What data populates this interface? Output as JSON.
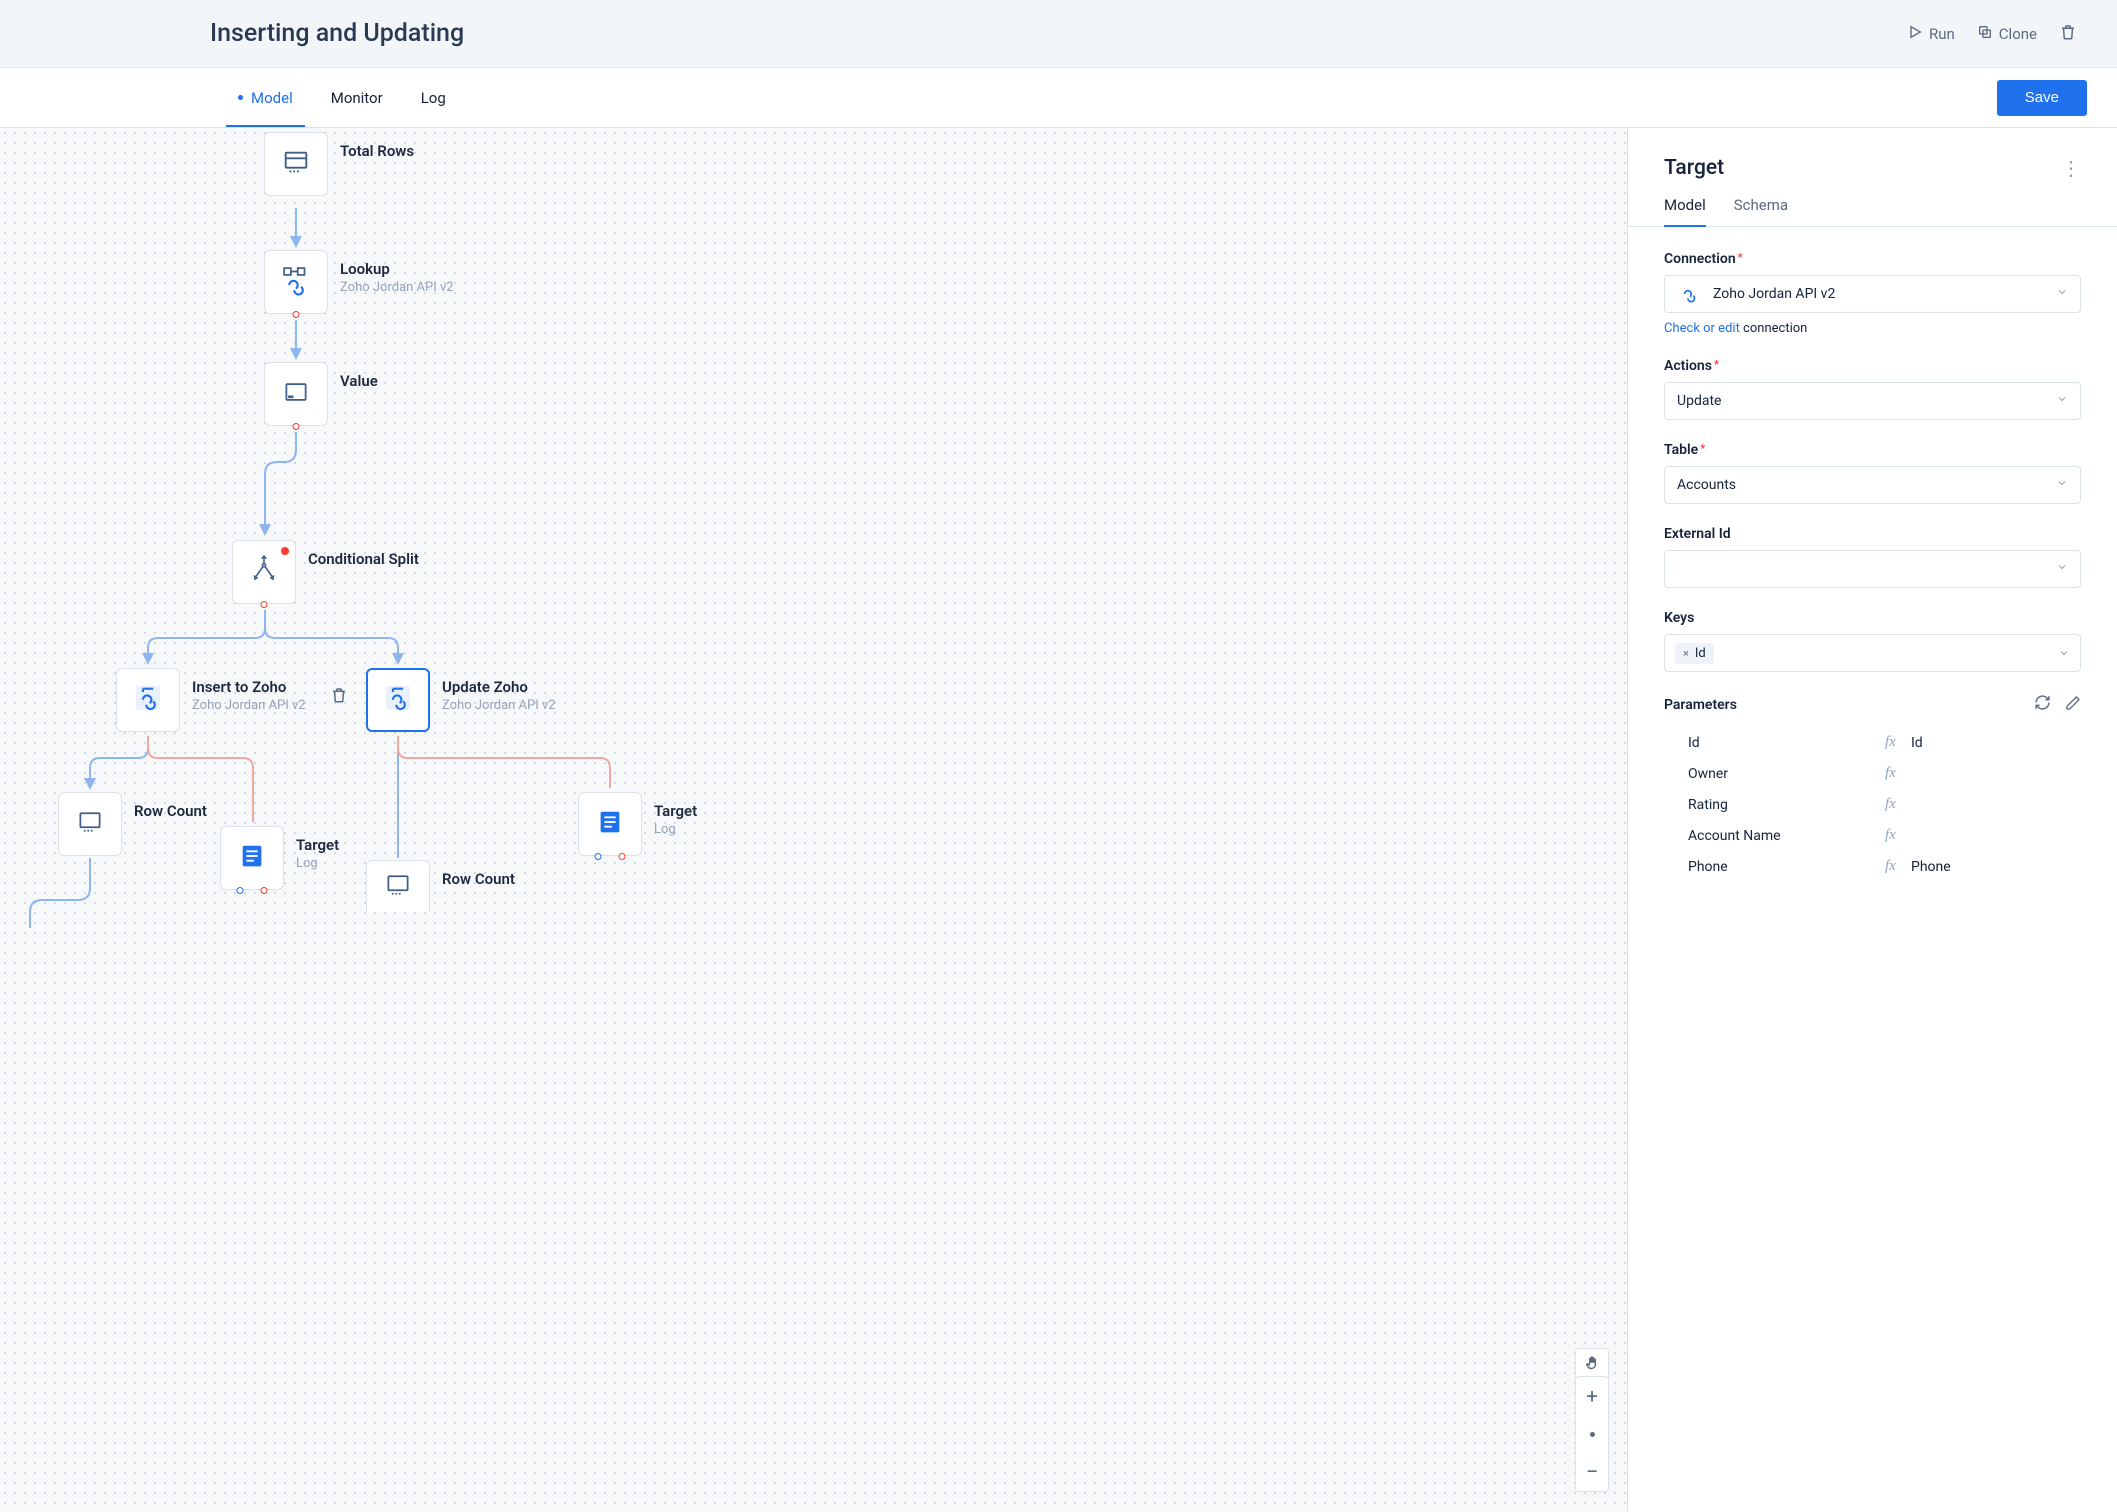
{
  "header": {
    "title": "Inserting and Updating",
    "run_label": "Run",
    "clone_label": "Clone"
  },
  "tabs": {
    "items": [
      {
        "label": "Model",
        "active": true
      },
      {
        "label": "Monitor",
        "active": false
      },
      {
        "label": "Log",
        "active": false
      }
    ],
    "save_label": "Save"
  },
  "canvas": {
    "nodes": {
      "total_rows": {
        "title": "Total Rows"
      },
      "lookup": {
        "title": "Lookup",
        "sub": "Zoho Jordan API v2"
      },
      "value": {
        "title": "Value"
      },
      "cond": {
        "title": "Conditional Split"
      },
      "insert": {
        "title": "Insert to Zoho",
        "sub": "Zoho Jordan API v2"
      },
      "update": {
        "title": "Update Zoho",
        "sub": "Zoho Jordan API v2"
      },
      "rc_left": {
        "title": "Row Count"
      },
      "target_left": {
        "title": "Target",
        "sub": "Log"
      },
      "rc_right": {
        "title": "Row Count"
      },
      "target_right": {
        "title": "Target",
        "sub": "Log"
      }
    }
  },
  "panel": {
    "title": "Target",
    "tabs": {
      "model": "Model",
      "schema": "Schema"
    },
    "connection_label": "Connection",
    "connection_value": "Zoho Jordan API v2",
    "check_link": "Check or edit",
    "check_rest": " connection",
    "actions_label": "Actions",
    "actions_value": "Update",
    "table_label": "Table",
    "table_value": "Accounts",
    "external_label": "External Id",
    "external_value": "",
    "keys_label": "Keys",
    "keys_chip": "Id",
    "parameters_label": "Parameters",
    "params": [
      {
        "name": "Id",
        "fx": "fx",
        "value": "Id"
      },
      {
        "name": "Owner",
        "fx": "fx",
        "value": ""
      },
      {
        "name": "Rating",
        "fx": "fx",
        "value": ""
      },
      {
        "name": "Account Name",
        "fx": "fx",
        "value": ""
      },
      {
        "name": "Phone",
        "fx": "fx",
        "value": "Phone"
      }
    ]
  }
}
